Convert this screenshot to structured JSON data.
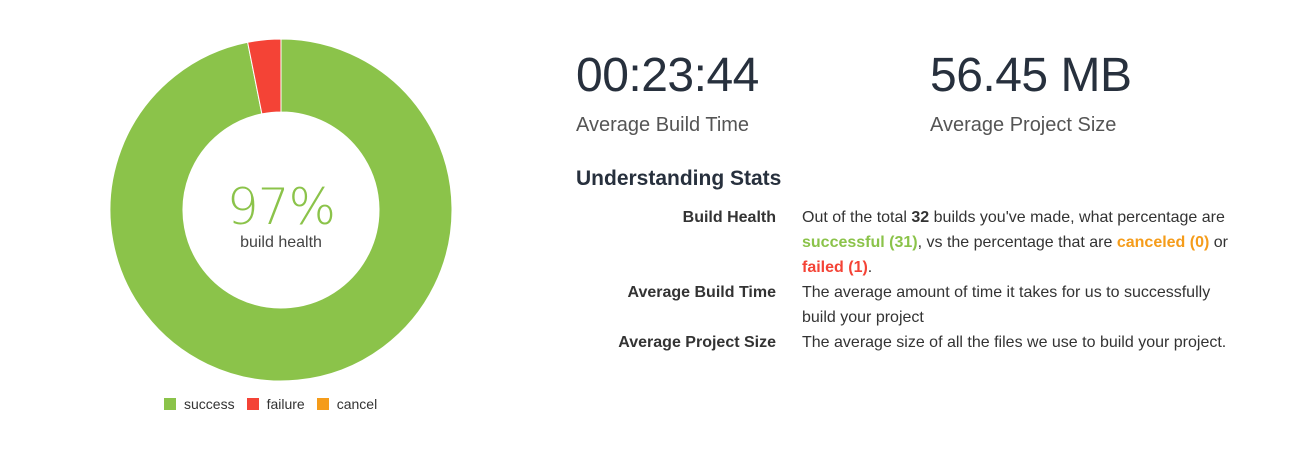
{
  "chart_data": {
    "type": "pie",
    "categories": [
      "success",
      "failure",
      "cancel"
    ],
    "values": [
      31,
      1,
      0
    ],
    "colors": {
      "success": "#8bc34a",
      "failure": "#f44336",
      "cancel": "#f59c1a"
    },
    "center_value": "97%",
    "center_label": "build health",
    "legend_position": "bottom"
  },
  "legend": [
    {
      "label": "success",
      "color": "#8bc34a"
    },
    {
      "label": "failure",
      "color": "#f44336"
    },
    {
      "label": "cancel",
      "color": "#f59c1a"
    }
  ],
  "stats": {
    "build_time": {
      "value": "00:23:44",
      "label": "Average Build Time"
    },
    "project_size": {
      "value": "56.45 MB",
      "label": "Average Project Size"
    }
  },
  "understanding": {
    "heading": "Understanding Stats",
    "build_health": {
      "term": "Build Health",
      "t1": "Out of the total ",
      "total": "32",
      "t2": " builds you've made, what percentage are ",
      "successful": "successful (31)",
      "t3": ", vs the percentage that are ",
      "canceled": "canceled (0)",
      "t4": " or ",
      "failed": "failed (1)",
      "t5": "."
    },
    "build_time": {
      "term": "Average Build Time",
      "definition": "The average amount of time it takes for us to successfully build your project"
    },
    "project_size": {
      "term": "Average Project Size",
      "definition": "The average size of all the files we use to build your project."
    }
  }
}
